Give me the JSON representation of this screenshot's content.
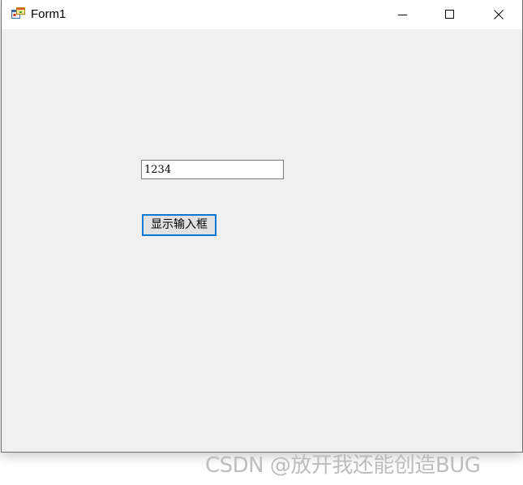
{
  "window": {
    "title": "Form1",
    "icon": "winforms-app-icon",
    "controls": {
      "minimize_icon": "minimize-icon",
      "maximize_icon": "maximize-icon",
      "close_icon": "close-icon"
    }
  },
  "form": {
    "textbox_value": "1234",
    "button_label": "显示输入框"
  },
  "watermark": "CSDN @放开我还能创造BUG",
  "colors": {
    "client_background": "#f0f0f0",
    "titlebar_background": "#ffffff",
    "focus_border": "#0078d7",
    "watermark_text": "#bdbdbd"
  }
}
